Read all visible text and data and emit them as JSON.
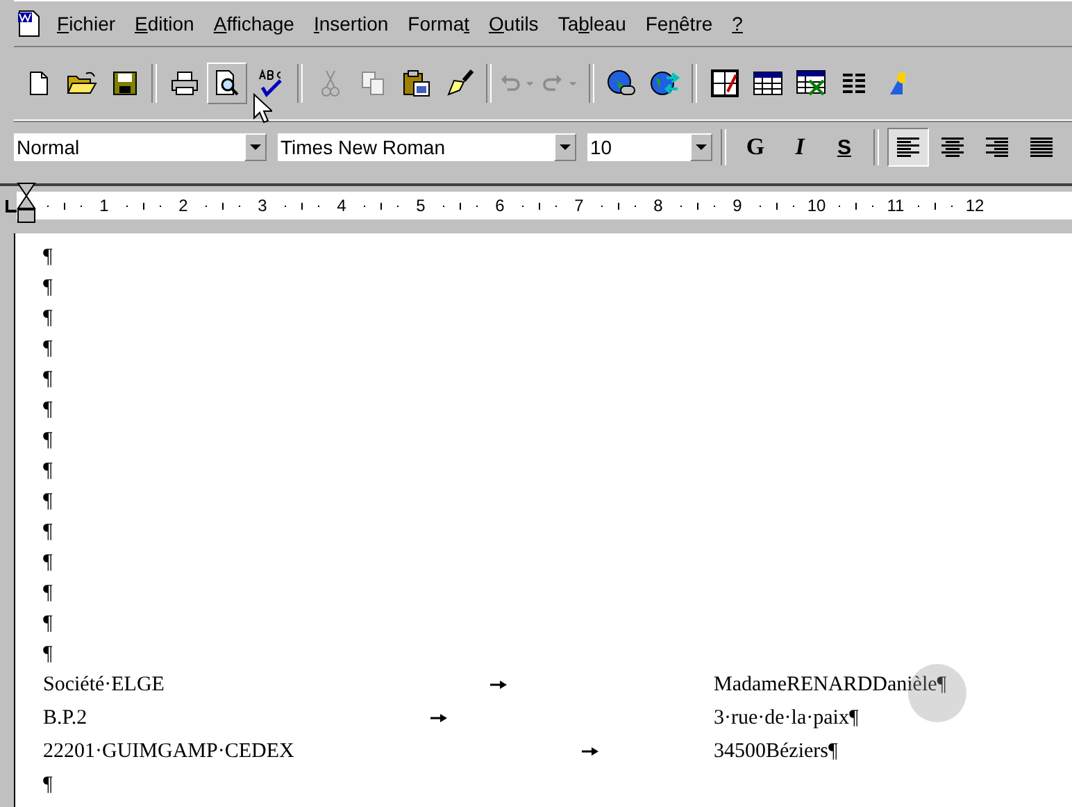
{
  "menu_bar": {
    "items": [
      {
        "label_parts": {
          "key": "F",
          "after": "ichier"
        }
      },
      {
        "label_parts": {
          "key": "E",
          "after": "dition"
        }
      },
      {
        "label_parts": {
          "key": "A",
          "after": "ffichage"
        }
      },
      {
        "label_parts": {
          "key": "I",
          "after": "nsertion"
        }
      },
      {
        "label_parts": {
          "before": "Forma",
          "key": "t"
        }
      },
      {
        "label_parts": {
          "key": "O",
          "after": "utils"
        }
      },
      {
        "label_parts": {
          "before": "Ta",
          "key": "b",
          "after": "leau"
        }
      },
      {
        "label_parts": {
          "before": "Fe",
          "key": "n",
          "after": "être"
        }
      },
      {
        "label_parts": {
          "key": "?"
        }
      }
    ]
  },
  "toolbar": {
    "groups": [
      [
        {
          "kind": "new",
          "disabled": false
        },
        {
          "kind": "open",
          "disabled": false
        },
        {
          "kind": "save",
          "disabled": false
        }
      ],
      [
        {
          "kind": "print",
          "disabled": false
        },
        {
          "kind": "preview",
          "disabled": false
        },
        {
          "kind": "spell",
          "disabled": false
        }
      ],
      [
        {
          "kind": "cut",
          "disabled": true
        },
        {
          "kind": "copy",
          "disabled": true
        },
        {
          "kind": "paste",
          "disabled": false
        },
        {
          "kind": "brush",
          "disabled": false
        }
      ],
      [
        {
          "kind": "undo",
          "disabled": true
        },
        {
          "kind": "redo",
          "disabled": true
        }
      ],
      [
        {
          "kind": "web",
          "disabled": false
        },
        {
          "kind": "globe",
          "disabled": false
        }
      ],
      [
        {
          "kind": "tables",
          "disabled": false
        },
        {
          "kind": "table",
          "disabled": false
        },
        {
          "kind": "excel",
          "disabled": false
        },
        {
          "kind": "columns",
          "disabled": false
        },
        {
          "kind": "drawing",
          "disabled": false
        }
      ]
    ]
  },
  "format_bar": {
    "style": "Normal",
    "font": "Times New Roman",
    "size": "10",
    "buttons": [
      {
        "label": "G",
        "kind": "bold"
      },
      {
        "label": "I",
        "kind": "italic"
      },
      {
        "label": "S",
        "kind": "underline"
      }
    ],
    "align": [
      {
        "kind": "left",
        "selected": true
      },
      {
        "kind": "center",
        "selected": false
      },
      {
        "kind": "right",
        "selected": false
      },
      {
        "kind": "justify",
        "selected": false
      }
    ]
  },
  "ruler": {
    "labels": [
      "1",
      "2",
      "3",
      "4",
      "5",
      "6",
      "7",
      "8",
      "9",
      "10",
      "11",
      "12"
    ]
  },
  "document": {
    "empty_lines": [
      "¶",
      "¶",
      "¶",
      "¶",
      "¶",
      "¶",
      "¶",
      "¶",
      "¶",
      "¶",
      "¶",
      "¶",
      "¶",
      "¶"
    ],
    "address_rows": [
      {
        "left": "Société·ELGE",
        "right": "MadameRENARDDanièle¶"
      },
      {
        "left": "B.P.2",
        "right": "3·rue·de·la·paix¶"
      },
      {
        "left": "22201·GUIMGAMP·CEDEX",
        "right": "34500Béziers¶"
      }
    ],
    "trailing_lines": [
      "¶"
    ]
  }
}
